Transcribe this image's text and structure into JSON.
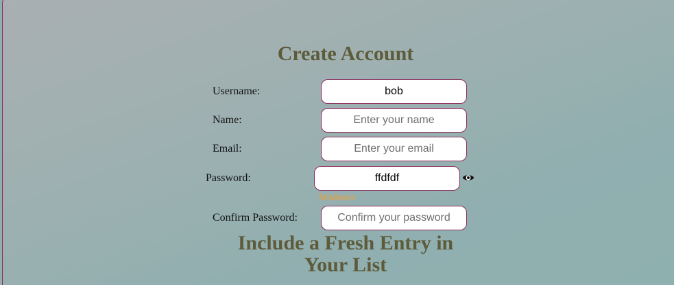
{
  "form": {
    "title": "Create Account",
    "username": {
      "label": "Username:",
      "value": "bob",
      "placeholder": ""
    },
    "name": {
      "label": "Name:",
      "value": "",
      "placeholder": "Enter your name"
    },
    "email": {
      "label": "Email:",
      "value": "",
      "placeholder": "Enter your email"
    },
    "password": {
      "label": "Password:",
      "value": "ffdfdf",
      "placeholder": "",
      "strength": "Moderate",
      "toggle_icon": "eye-icon"
    },
    "confirm_password": {
      "label": "Confirm Password:",
      "value": "",
      "placeholder": "Confirm your password"
    }
  },
  "section": {
    "heading_line1": "Include a Fresh Entry in",
    "heading_line2": "Your List"
  },
  "colors": {
    "accent_border": "#8b2c5c",
    "heading": "#5d5b3a",
    "strength_moderate": "#f0a030"
  }
}
